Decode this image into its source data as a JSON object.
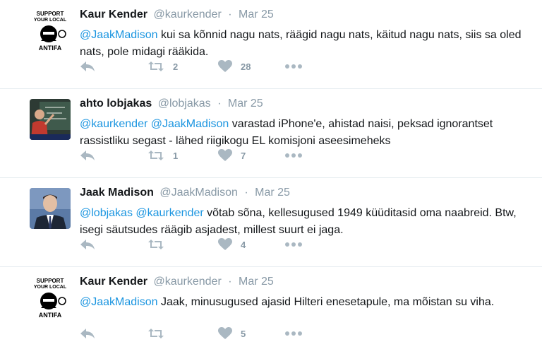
{
  "tweets": [
    {
      "name": "Kaur Kender",
      "handle": "@kaurkender",
      "sep": "·",
      "date": "Mar 25",
      "avatar": "antifa-logo-avatar",
      "avatar_text": [
        "SUPPORT",
        "YOUR LOCAL",
        "ANTIFA"
      ],
      "mentions": [
        "@JaakMadison"
      ],
      "body": " kui sa kõnnid nagu nats, räägid nagu nats, käitud nagu nats, siis sa oled nats, pole midagi rääkida.",
      "retweets": "2",
      "likes": "28"
    },
    {
      "name": "ahto lobjakas",
      "handle": "@lobjakas",
      "sep": "·",
      "date": "Mar 25",
      "avatar": "chalkboard-photo-avatar",
      "mentions": [
        "@kaurkender",
        "@JaakMadison"
      ],
      "body": " varastad iPhone'e, ahistad naisi, peksad ignorantset rassistliku segast - lähed riigikogu EL komisjoni aseesimeheks",
      "retweets": "1",
      "likes": "7"
    },
    {
      "name": "Jaak Madison",
      "handle": "@JaakMadison",
      "sep": "·",
      "date": "Mar 25",
      "avatar": "portrait-photo-avatar",
      "mentions": [
        "@lobjakas",
        "@kaurkender"
      ],
      "body": " võtab sõna, kellesugused 1949 küüditasid oma naabreid. Btw, isegi säutsudes räägib asjadest, millest suurt ei jaga.",
      "retweets": "",
      "likes": "4"
    },
    {
      "name": "Kaur Kender",
      "handle": "@kaurkender",
      "sep": "·",
      "date": "Mar 25",
      "avatar": "antifa-logo-avatar",
      "avatar_text": [
        "SUPPORT",
        "YOUR LOCAL",
        "ANTIFA"
      ],
      "mentions": [
        "@JaakMadison"
      ],
      "body": " Jaak, minusugused ajasid Hilteri enesetapule, ma mõistan su viha.",
      "retweets": "",
      "likes": "5"
    }
  ],
  "icons": {
    "reply": "reply-icon",
    "retweet": "retweet-icon",
    "like": "heart-icon",
    "more": "more-dots-icon"
  },
  "colors": {
    "link": "#1b95e0",
    "muted": "#8899a6",
    "icon": "#aab8c2",
    "divider": "#e6ecf0"
  }
}
